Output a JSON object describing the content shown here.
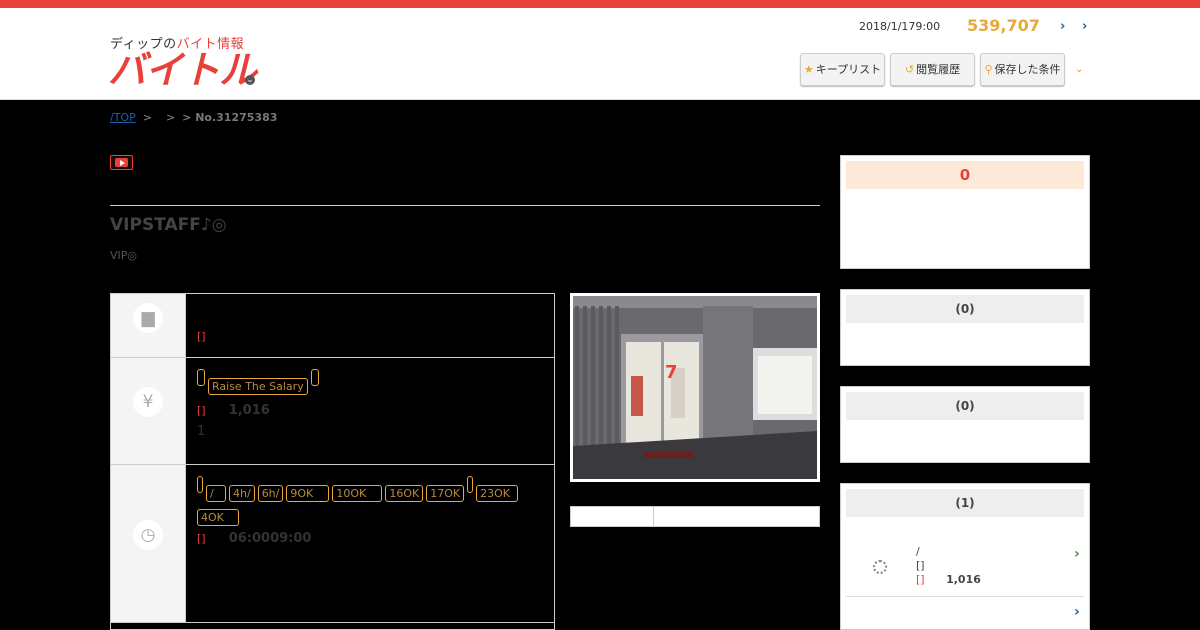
{
  "header": {
    "logo_prefix": "ディップの",
    "logo_highlight": "バイト情報",
    "logo_name": "バイトル",
    "date": "2018/1/179:00",
    "job_count": "539,707",
    "buttons": [
      {
        "label": "キープリスト",
        "icon": "star-icon"
      },
      {
        "label": "閲覧履歴",
        "icon": "history-icon"
      },
      {
        "label": "保存した条件",
        "icon": "search-icon"
      }
    ]
  },
  "breadcrumb": {
    "top": "/TOP",
    "sep1": ">",
    "sep2": ">",
    "current": "> No.31275383"
  },
  "job": {
    "title": "VIPSTAFF♪◎",
    "subtitle": "VIP◎"
  },
  "rows": {
    "work": {
      "note": "[]"
    },
    "pay": {
      "tag_a": "",
      "tag_raise": "Raise The Salary",
      "tag_b": "",
      "bracket": "[]",
      "amount": "1,016",
      "extra": "1"
    },
    "time": {
      "tags": [
        "",
        "/",
        "4h/",
        "6h/",
        "9OK",
        "10OK",
        "16OK",
        "17OK",
        "",
        "23OK",
        "4OK"
      ],
      "bracket": "[]",
      "hours": "06:0009:00"
    }
  },
  "sidebar": {
    "box1_count": "0",
    "box2_count": "(0)",
    "box3_count": "(0)",
    "box4_count": "(1)",
    "item_slash": "/",
    "item_bracket1": "[]",
    "item_bracket2": "[]",
    "item_amount": "1,016"
  }
}
